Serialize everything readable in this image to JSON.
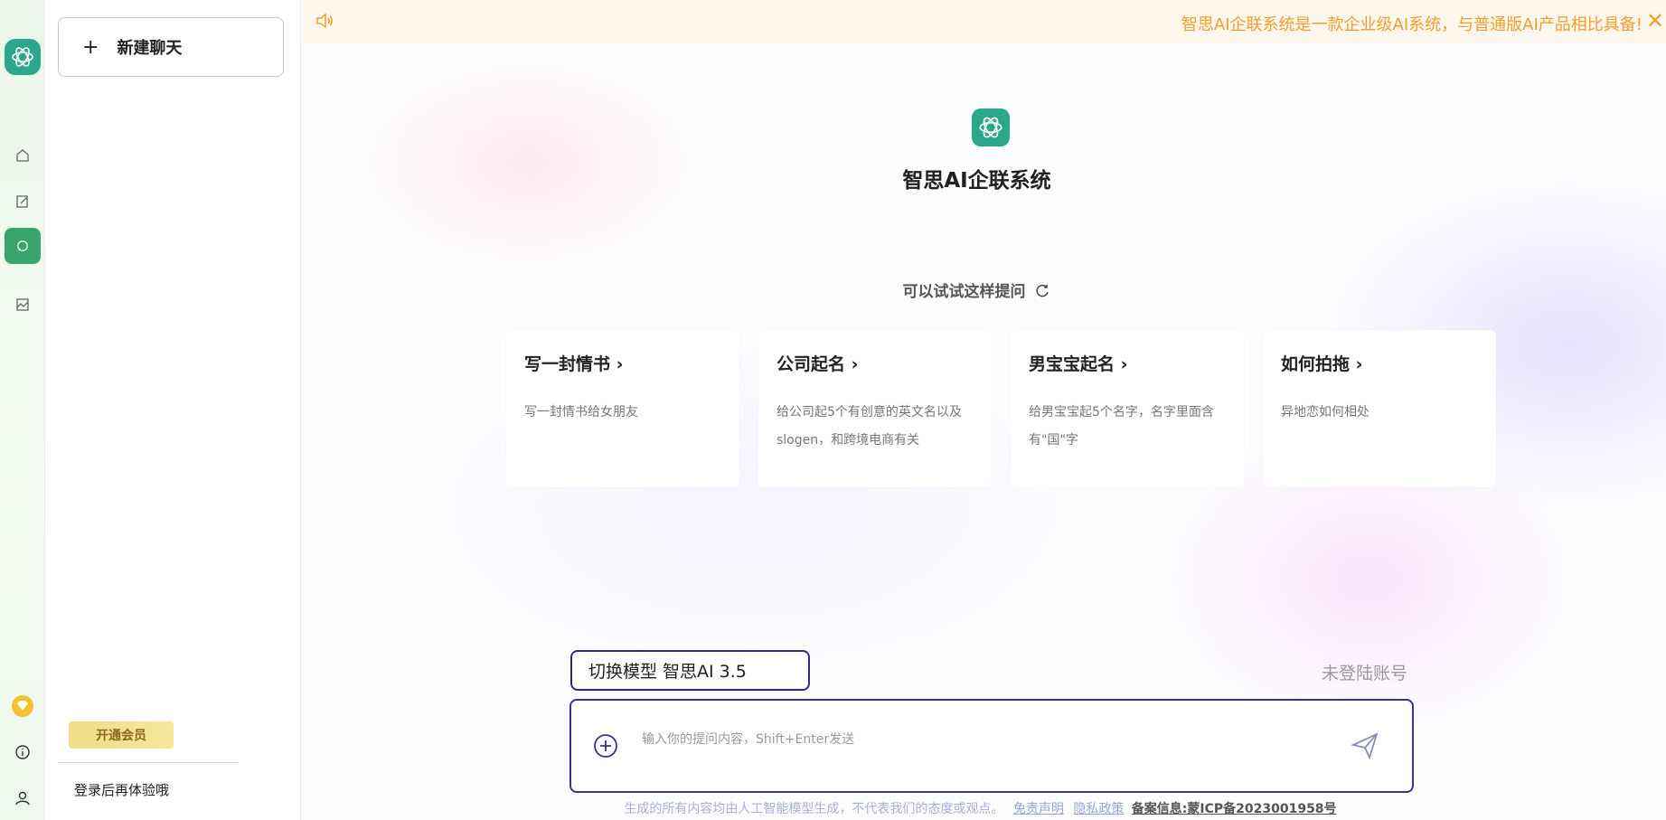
{
  "rail": {
    "icons": [
      "logo-icon",
      "home-icon",
      "edit-icon",
      "chat-icon",
      "image-icon",
      "vip-diamond-icon",
      "info-icon",
      "user-icon"
    ],
    "active_color": "#3aa56a"
  },
  "sidebar": {
    "new_chat_label": "新建聊天",
    "vip_label": "开通会员",
    "login_tip": "登录后再体验哦"
  },
  "notice": {
    "text": "智思AI企联系统是一款企业级AI系统，与普通版AI产品相比具备!",
    "color": "#f0a030"
  },
  "brand": {
    "title": "智思AI企联系统",
    "accent": "#2aa889"
  },
  "suggestions": {
    "heading": "可以试试这样提问",
    "cards": [
      {
        "title": "写一封情书",
        "desc": "写一封情书给女朋友"
      },
      {
        "title": "公司起名",
        "desc": "给公司起5个有创意的英文名以及slogen，和跨境电商有关"
      },
      {
        "title": "男宝宝起名",
        "desc": "给男宝宝起5个名字，名字里面含有\"国\"字"
      },
      {
        "title": "如何拍拖",
        "desc": "异地恋如何相处"
      }
    ]
  },
  "composer": {
    "model_label": "切换模型 智思AI 3.5",
    "login_status": "未登陆账号",
    "placeholder": "输入你的提问内容，Shift+Enter发送",
    "value": ""
  },
  "footer": {
    "disclaimer": "生成的所有内容均由人工智能模型生成，不代表我们的态度或观点。",
    "terms_link": "免责声明",
    "privacy_link": "隐私政策",
    "icp": "备案信息:蒙ICP备2023001958号"
  }
}
